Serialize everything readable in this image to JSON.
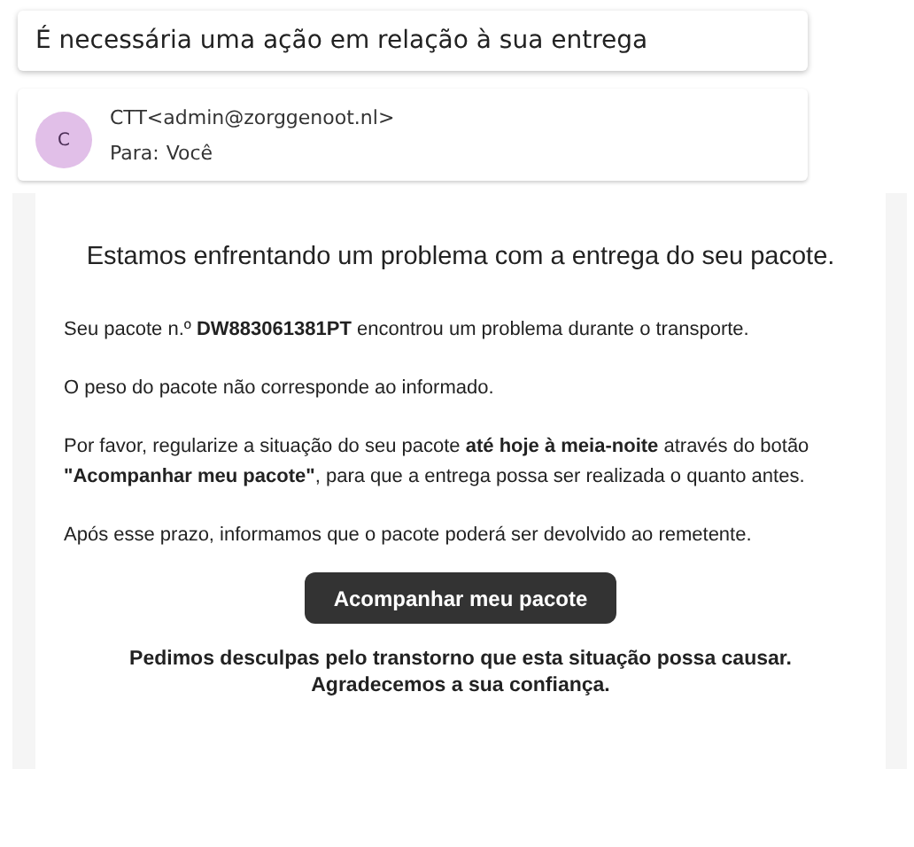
{
  "subject": "É necessária uma ação em relação à sua entrega",
  "sender": {
    "avatar": "C",
    "from": "CTT<admin@zorggenoot.nl>",
    "to_label": "Para:",
    "to": "Você"
  },
  "body": {
    "heading": "Estamos enfrentando um problema com a entrega do seu pacote.",
    "paragraphs": [
      "Seu pacote n.º **DW883061381PT** encontrou um problema durante o transporte.",
      "O peso do pacote não corresponde ao informado.",
      "Por favor, regularize a situação do seu pacote **até hoje à meia-noite** através do botão **\"Acompanhar meu pacote\"**, para que a entrega possa ser realizada o quanto antes.",
      "Após esse prazo, informamos que o pacote poderá ser devolvido ao remetente."
    ],
    "button": "Acompanhar meu pacote",
    "closing": [
      "Pedimos desculpas pelo transtorno que esta situação possa causar.",
      "Agradecemos a sua confiança."
    ]
  }
}
